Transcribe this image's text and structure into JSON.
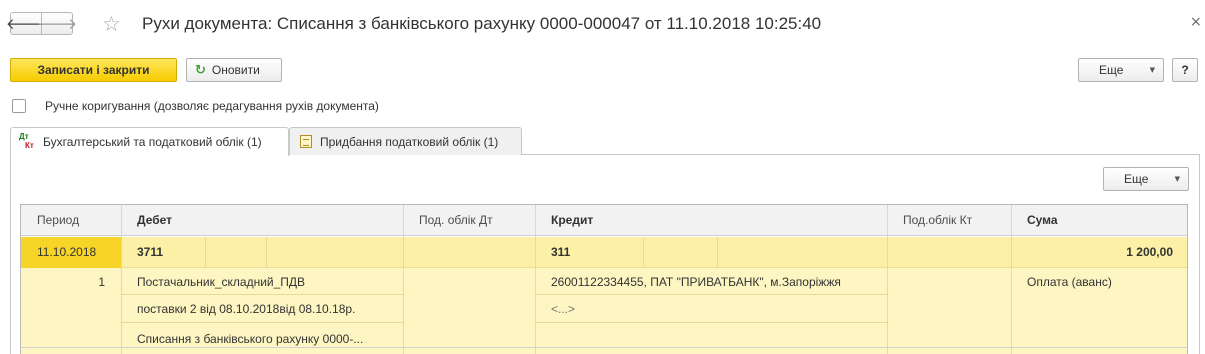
{
  "window": {
    "title": "Рухи документа: Списання з банківського рахунку 0000-000047 от 11.10.2018 10:25:40",
    "back_icon": "arrow-left-icon",
    "forward_icon": "arrow-right-icon",
    "favorite_icon": "star-icon",
    "close_icon": "close-icon",
    "back_glyph": "🡐",
    "forward_glyph": "🡒",
    "star_glyph": "☆",
    "close_glyph": "×"
  },
  "toolbar": {
    "save_close_label": "Записати і закрити",
    "refresh_label": "Оновити",
    "refresh_glyph": "↻",
    "more_label": "Еще",
    "help_label": "?",
    "caret_glyph": "▼"
  },
  "manual_edit": {
    "label": "Ручне коригування (дозволяє редагування рухів документа)",
    "checked": false
  },
  "tabs": [
    {
      "label": "Бухгалтерський та податковий облік (1)",
      "icon": "dt-kt-icon",
      "active": true,
      "dt": "Дт",
      "kt": "Кт"
    },
    {
      "label": "Придбання податковий облік (1)",
      "icon": "document-icon",
      "active": false
    }
  ],
  "grid": {
    "more_label": "Еще",
    "columns": {
      "period": "Период",
      "debit": "Дебет",
      "sub_debit": "Под. облік Дт",
      "credit": "Кредит",
      "sub_credit": "Под.облік Кт",
      "amount": "Сума"
    },
    "row": {
      "period": "11.10.2018",
      "line_no": "1",
      "debit_account": "3711",
      "debit_subconto": [
        "Постачальник_складний_ПДВ",
        "поставки 2 від 08.10.2018від 08.10.18р.",
        "Списання з банківського рахунку 0000-..."
      ],
      "credit_account": "311",
      "credit_subconto": [
        "26001122334455, ПАТ \"ПРИВАТБАНК\", м.Запоріжжя",
        "<...>"
      ],
      "amount": "1 200,00",
      "content": "Оплата (аванс)"
    }
  },
  "colors": {
    "primary_button": "#f5cb00",
    "selected_row": "#fbf0a6",
    "current_cell": "#f7d528"
  }
}
